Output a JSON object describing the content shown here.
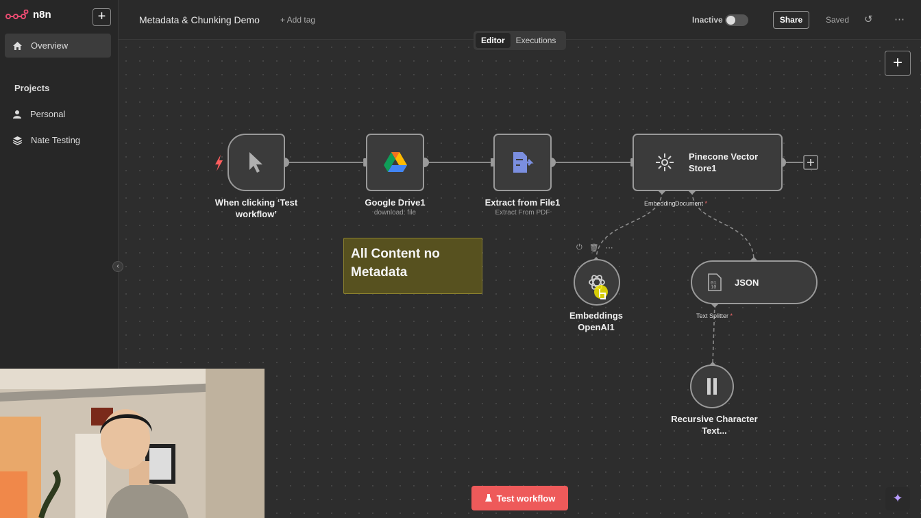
{
  "app": {
    "name": "n8n"
  },
  "sidebar": {
    "items": [
      {
        "label": "Overview",
        "icon": "home-icon"
      },
      {
        "label": "Personal",
        "icon": "user-icon"
      },
      {
        "label": "Nate Testing",
        "icon": "layers-icon"
      }
    ],
    "projects_label": "Projects"
  },
  "header": {
    "title": "Metadata & Chunking Demo",
    "add_tag": "+ Add tag",
    "status": "Inactive",
    "share": "Share",
    "saved": "Saved"
  },
  "tabs": [
    {
      "label": "Editor",
      "active": true
    },
    {
      "label": "Executions",
      "active": false
    }
  ],
  "nodes": {
    "trigger": {
      "title": "When clicking ‘Test workflow’"
    },
    "gdrive": {
      "title": "Google Drive1",
      "subtitle": "download: file"
    },
    "extract": {
      "title": "Extract from File1",
      "subtitle": "Extract From PDF"
    },
    "pinecone": {
      "title": "Pinecone Vector Store1"
    },
    "embeddings": {
      "title": "Embeddings OpenAI1"
    },
    "json": {
      "title": "JSON"
    },
    "splitter": {
      "title": "Recursive Character Text..."
    }
  },
  "ports": {
    "embedding": "Embedding",
    "document": "Document",
    "text_splitter": "Text Splitter",
    "required_marker": "*"
  },
  "sticky": {
    "text": "All Content no Metadata"
  },
  "footer": {
    "test_button": "Test workflow"
  },
  "colors": {
    "accent": "#ee5a5a",
    "sticky": "#57511f",
    "canvas": "#2d2d2d"
  }
}
